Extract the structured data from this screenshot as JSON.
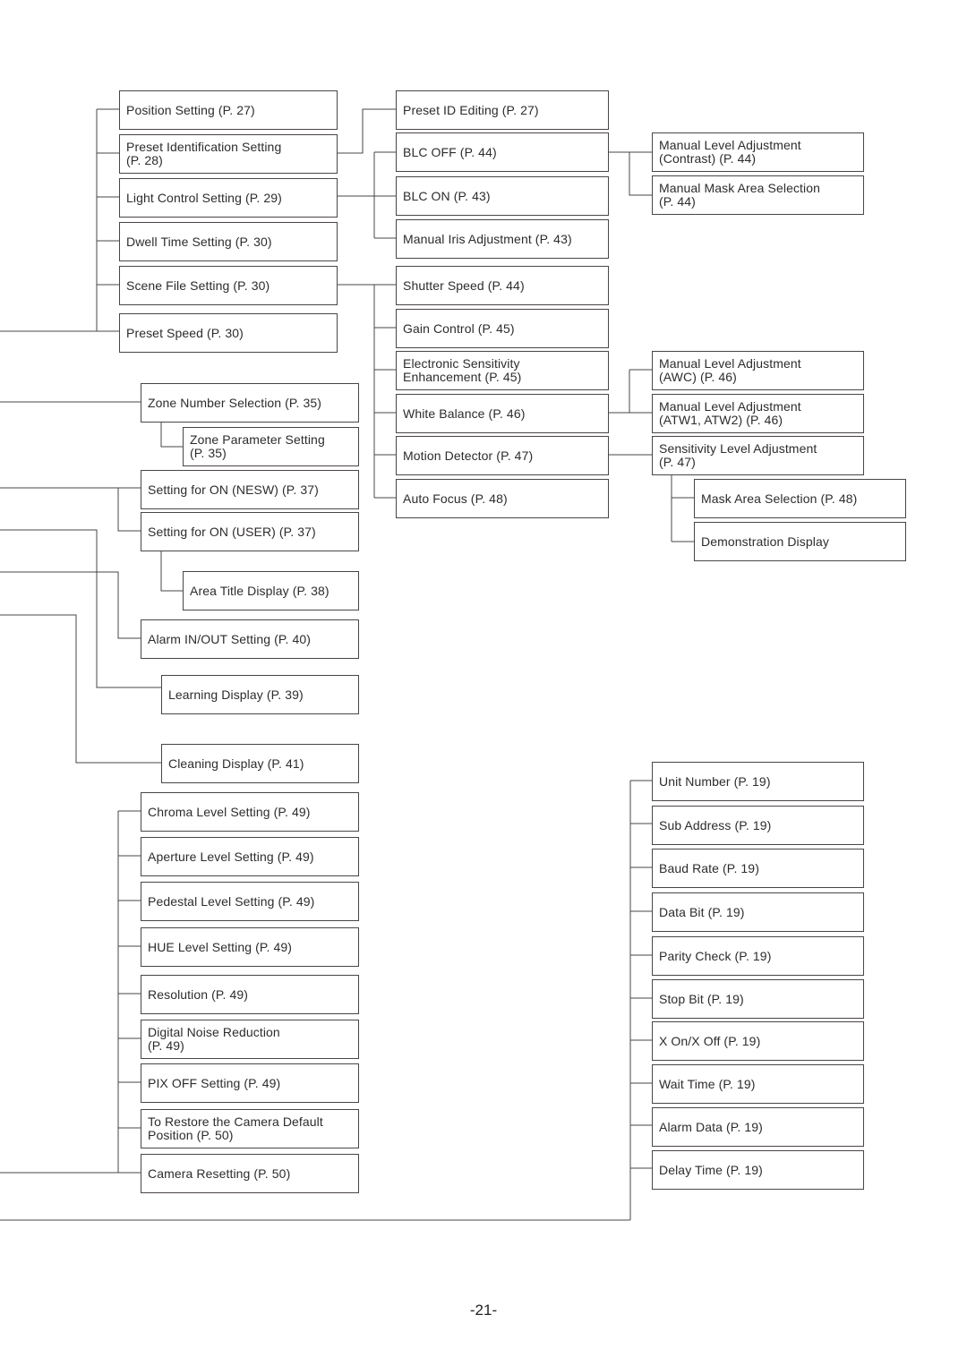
{
  "page_number": "-21-",
  "tree": {
    "preset_menu": {
      "items": [
        "Position Setting (P. 27)",
        "Preset Identification Setting\n(P. 28)",
        "Light Control Setting (P. 29)",
        "Dwell Time Setting (P. 30)",
        "Scene File Setting (P. 30)",
        "Preset Speed (P. 30)"
      ]
    },
    "preset_identification_sub": {
      "items": [
        "Preset ID Editing (P. 27)"
      ]
    },
    "light_control_sub": {
      "items": [
        "BLC OFF (P. 44)",
        "BLC ON (P. 43)",
        "Manual Iris Adjustment (P. 43)"
      ]
    },
    "blc_off_sub": {
      "items": [
        "Manual Level Adjustment\n(Contrast) (P. 44)",
        "Manual Mask Area Selection\n(P. 44)"
      ]
    },
    "scene_file_sub": {
      "items": [
        "Shutter Speed (P. 44)",
        "Gain Control (P. 45)",
        "Electronic Sensitivity\nEnhancement (P. 45)",
        "White Balance (P. 46)",
        "Motion Detector (P. 47)",
        "Auto Focus (P. 48)"
      ]
    },
    "white_balance_sub": {
      "items": [
        "Manual Level Adjustment\n(AWC) (P. 46)",
        "Manual Level Adjustment\n(ATW1, ATW2) (P. 46)"
      ]
    },
    "motion_detector_sub": {
      "items": [
        "Sensitivity Level Adjustment\n(P. 47)"
      ]
    },
    "sensitivity_level_sub": {
      "items": [
        "Mask Area Selection (P. 48)",
        "Demonstration Display"
      ]
    },
    "zone_menu": {
      "items": [
        "Zone Number Selection (P. 35)",
        "Zone Parameter Setting\n(P. 35)"
      ]
    },
    "area_title_menu": {
      "items": [
        "Setting for ON (NESW) (P. 37)",
        "Setting for ON (USER) (P. 37)",
        "Area Title Display (P. 38)"
      ]
    },
    "alarm_menu": {
      "items": [
        "Alarm IN/OUT Setting (P. 40)"
      ]
    },
    "learning_menu": {
      "items": [
        "Learning Display (P. 39)"
      ]
    },
    "cleaning_menu": {
      "items": [
        "Cleaning Display (P. 41)"
      ]
    },
    "picture_menu": {
      "items": [
        "Chroma Level Setting (P. 49)",
        "Aperture Level Setting (P. 49)",
        "Pedestal Level Setting (P. 49)",
        "HUE Level Setting (P. 49)",
        "Resolution (P. 49)",
        "Digital Noise Reduction\n(P. 49)",
        "PIX OFF Setting (P. 49)",
        "To Restore the Camera Default\nPosition (P. 50)",
        "Camera Resetting (P. 50)"
      ]
    },
    "communication_menu": {
      "items": [
        "Unit Number (P. 19)",
        "Sub Address (P. 19)",
        "Baud Rate (P. 19)",
        "Data Bit (P. 19)",
        "Parity Check (P. 19)",
        "Stop Bit (P. 19)",
        "X On/X Off (P. 19)",
        "Wait Time (P. 19)",
        "Alarm Data (P. 19)",
        "Delay Time (P. 19)"
      ]
    }
  }
}
